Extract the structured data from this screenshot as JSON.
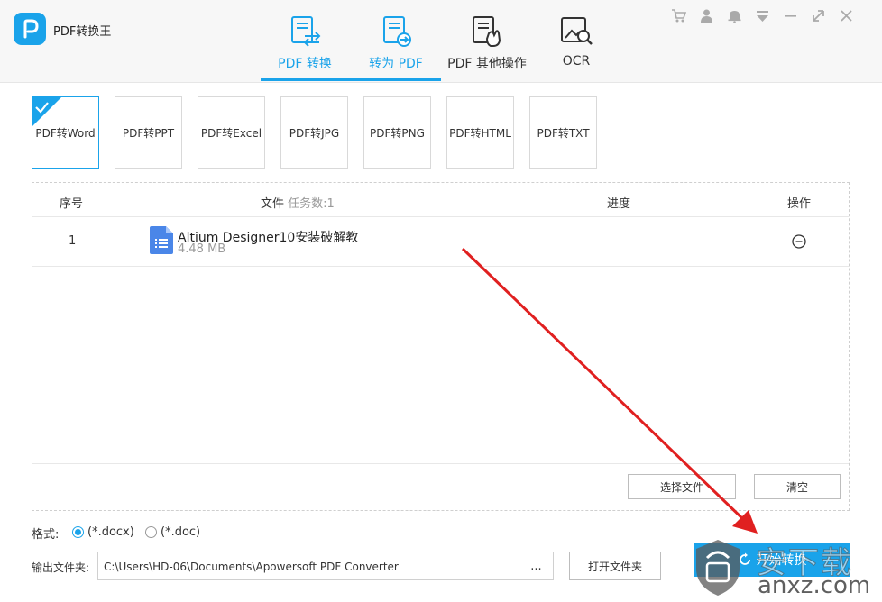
{
  "app": {
    "title": "PDF转换王"
  },
  "nav": {
    "tabs": [
      {
        "label": "PDF 转换",
        "icon": "pdf-convert-icon"
      },
      {
        "label": "转为 PDF",
        "icon": "to-pdf-icon"
      },
      {
        "label": "PDF 其他操作",
        "icon": "pdf-tools-icon"
      },
      {
        "label": "OCR",
        "icon": "ocr-icon"
      }
    ]
  },
  "window_controls": [
    "cart-icon",
    "user-icon",
    "bell-icon",
    "menu-icon",
    "minimize-icon",
    "maximize-icon",
    "close-icon"
  ],
  "formats": [
    {
      "label": "PDF转Word",
      "selected": true
    },
    {
      "label": "PDF转PPT"
    },
    {
      "label": "PDF转Excel"
    },
    {
      "label": "PDF转JPG"
    },
    {
      "label": "PDF转PNG"
    },
    {
      "label": "PDF转HTML"
    },
    {
      "label": "PDF转TXT"
    }
  ],
  "table": {
    "headers": {
      "index": "序号",
      "file": "文件",
      "task_count": "任务数:1",
      "progress": "进度",
      "action": "操作"
    },
    "rows": [
      {
        "index": "1",
        "name": "Altium Designer10安装破解教",
        "size": "4.48 MB"
      }
    ],
    "select_file_label": "选择文件",
    "clear_label": "清空"
  },
  "format_options": {
    "label": "格式:",
    "options": [
      {
        "label": "(*.docx)",
        "checked": true
      },
      {
        "label": "(*.doc)",
        "checked": false
      }
    ]
  },
  "output": {
    "label": "输出文件夹:",
    "path": "C:\\Users\\HD-06\\Documents\\Apowersoft PDF Converter",
    "browse_label": "...",
    "open_folder_label": "打开文件夹"
  },
  "start_label": "开始转换",
  "watermark": {
    "title": "安下载",
    "site": "anxz.com"
  },
  "colors": {
    "accent": "#1aa3ea",
    "annotation_arrow": "#e02020"
  }
}
